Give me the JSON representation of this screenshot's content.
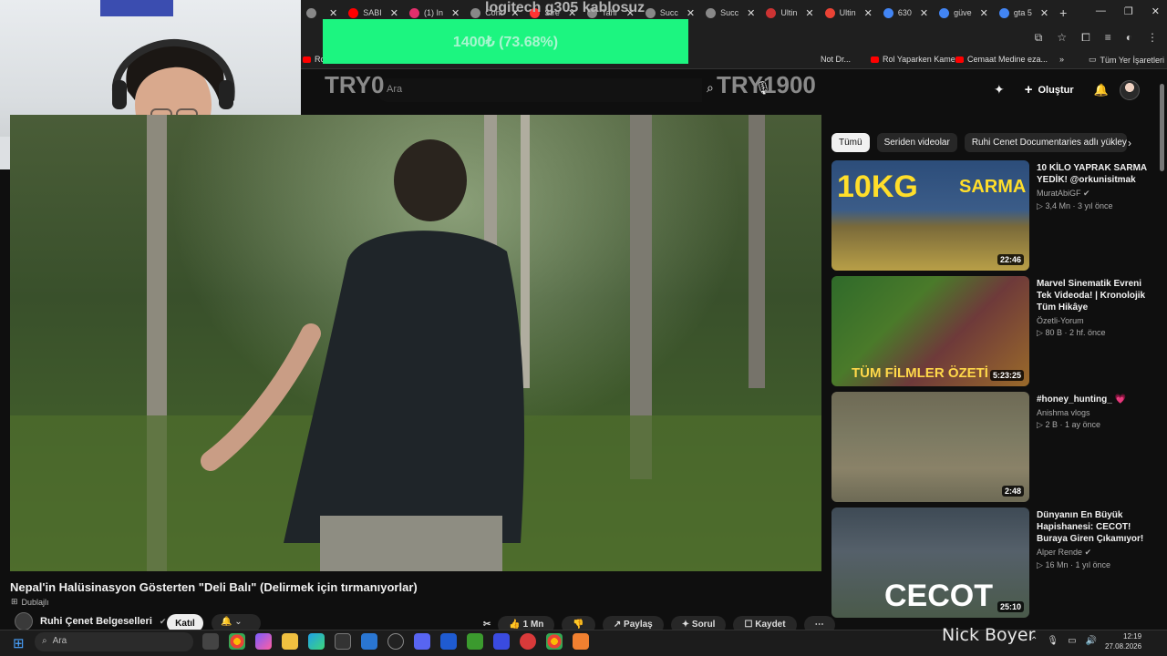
{
  "overlay": {
    "title": "logitech g305 kablosuz",
    "goal": "1400₺ (73.68%)",
    "goal_progress": 0.7368,
    "try_left": "TRY0",
    "try_right": "TRY1900",
    "streamer_name": "Nick Boyer",
    "goal_color": "#1cf580"
  },
  "browser": {
    "tabs": [
      {
        "label": "",
        "icon": "generic-icon",
        "color": "#888888"
      },
      {
        "label": "SABI",
        "icon": "youtube-icon",
        "color": "#ff0000"
      },
      {
        "label": "(1) In",
        "icon": "instagram-icon",
        "color": "#e1306c"
      },
      {
        "label": "Cont",
        "icon": "generic-icon",
        "color": "#888888"
      },
      {
        "label": "Stre",
        "icon": "stream-icon",
        "color": "#ff3333"
      },
      {
        "label": "Tahr",
        "icon": "generic-icon",
        "color": "#888888"
      },
      {
        "label": "Succ",
        "icon": "generic-icon",
        "color": "#888888"
      },
      {
        "label": "Succ",
        "icon": "generic-icon",
        "color": "#888888"
      },
      {
        "label": "Ultin",
        "icon": "generic-icon",
        "color": "#cc3333"
      },
      {
        "label": "Ultin",
        "icon": "chrome-icon",
        "color": "#ea4335"
      },
      {
        "label": "630",
        "icon": "google-icon",
        "color": "#4285f4"
      },
      {
        "label": "güve",
        "icon": "google-icon",
        "color": "#4285f4"
      },
      {
        "label": "gta 5",
        "icon": "google-icon",
        "color": "#4285f4"
      }
    ],
    "bookmarks": [
      {
        "label": "Ro"
      },
      {
        "label": "Not Dr..."
      },
      {
        "label": "Rol Yaparken Kamer..."
      },
      {
        "label": "Cemaat Medine eza..."
      },
      {
        "label": "Tüm Yer İşaretleri"
      }
    ]
  },
  "youtube": {
    "search_placeholder": "Ara",
    "create_label": "Oluştur",
    "video_title": "Nepal'in Halüsinasyon Gösterten \"Deli Balı\" (Delirmek için tırmanıyorlar)",
    "dub_label": "Dublajlı",
    "channel_name": "Ruhi Çenet Belgeselleri",
    "join_label": "Katıl",
    "actions": {
      "likes": "1 Mn",
      "share": "Paylaş",
      "ask": "Sorul",
      "save": "Kaydet"
    },
    "chips": [
      "Tümü",
      "Seriden videolar",
      "Ruhi Cenet Documentaries adlı yükleyici"
    ],
    "recommendations": [
      {
        "title": "10 KİLO YAPRAK SARMA YEDİK! @orkunisitmak",
        "channel": "MuratAbiGF",
        "views": "3,4 Mn",
        "age": "3 yıl önce",
        "duration": "22:46",
        "thumb_text": "10KG SARMA"
      },
      {
        "title": "Marvel Sinematik Evreni Tek Videoda! | Kronolojik Tüm Hikâye",
        "channel": "Özetli-Yorum",
        "views": "80 B",
        "age": "2 hf. önce",
        "duration": "5:23:25",
        "thumb_text": "TÜM FİLMLER ÖZETİ"
      },
      {
        "title": "#honey_hunting_ 💗",
        "channel": "Anishma vlogs",
        "views": "2 B",
        "age": "1 ay önce",
        "duration": "2:48",
        "thumb_text": ""
      },
      {
        "title": "Dünyanın En Büyük Hapishanesi: CECOT! Buraya Giren Çıkamıyor!",
        "channel": "Alper Rende",
        "views": "16 Mn",
        "age": "1 yıl önce",
        "duration": "25:10",
        "thumb_text": "CECOT"
      }
    ]
  },
  "taskbar": {
    "search_placeholder": "Ara",
    "time": "12:19",
    "date": "27.08.2026"
  }
}
